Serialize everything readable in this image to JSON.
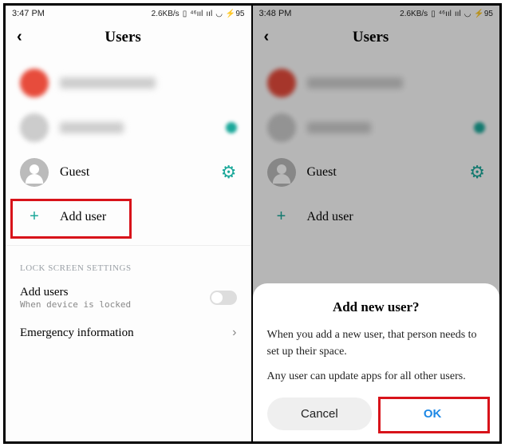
{
  "status": {
    "time_left": "3:47 PM",
    "time_right": "3:48 PM",
    "speed": "2.6KB/s",
    "battery": "95"
  },
  "header": {
    "title": "Users"
  },
  "users": {
    "guest_label": "Guest"
  },
  "add_user": {
    "label": "Add user"
  },
  "lock_section": {
    "heading": "LOCK SCREEN SETTINGS",
    "add_users_title": "Add users",
    "add_users_sub": "When device is locked",
    "emergency_title": "Emergency information"
  },
  "dialog": {
    "title": "Add new user?",
    "body1": "When you add a new user, that person needs to set up their space.",
    "body2": "Any user can update apps for all other users.",
    "cancel": "Cancel",
    "ok": "OK"
  }
}
